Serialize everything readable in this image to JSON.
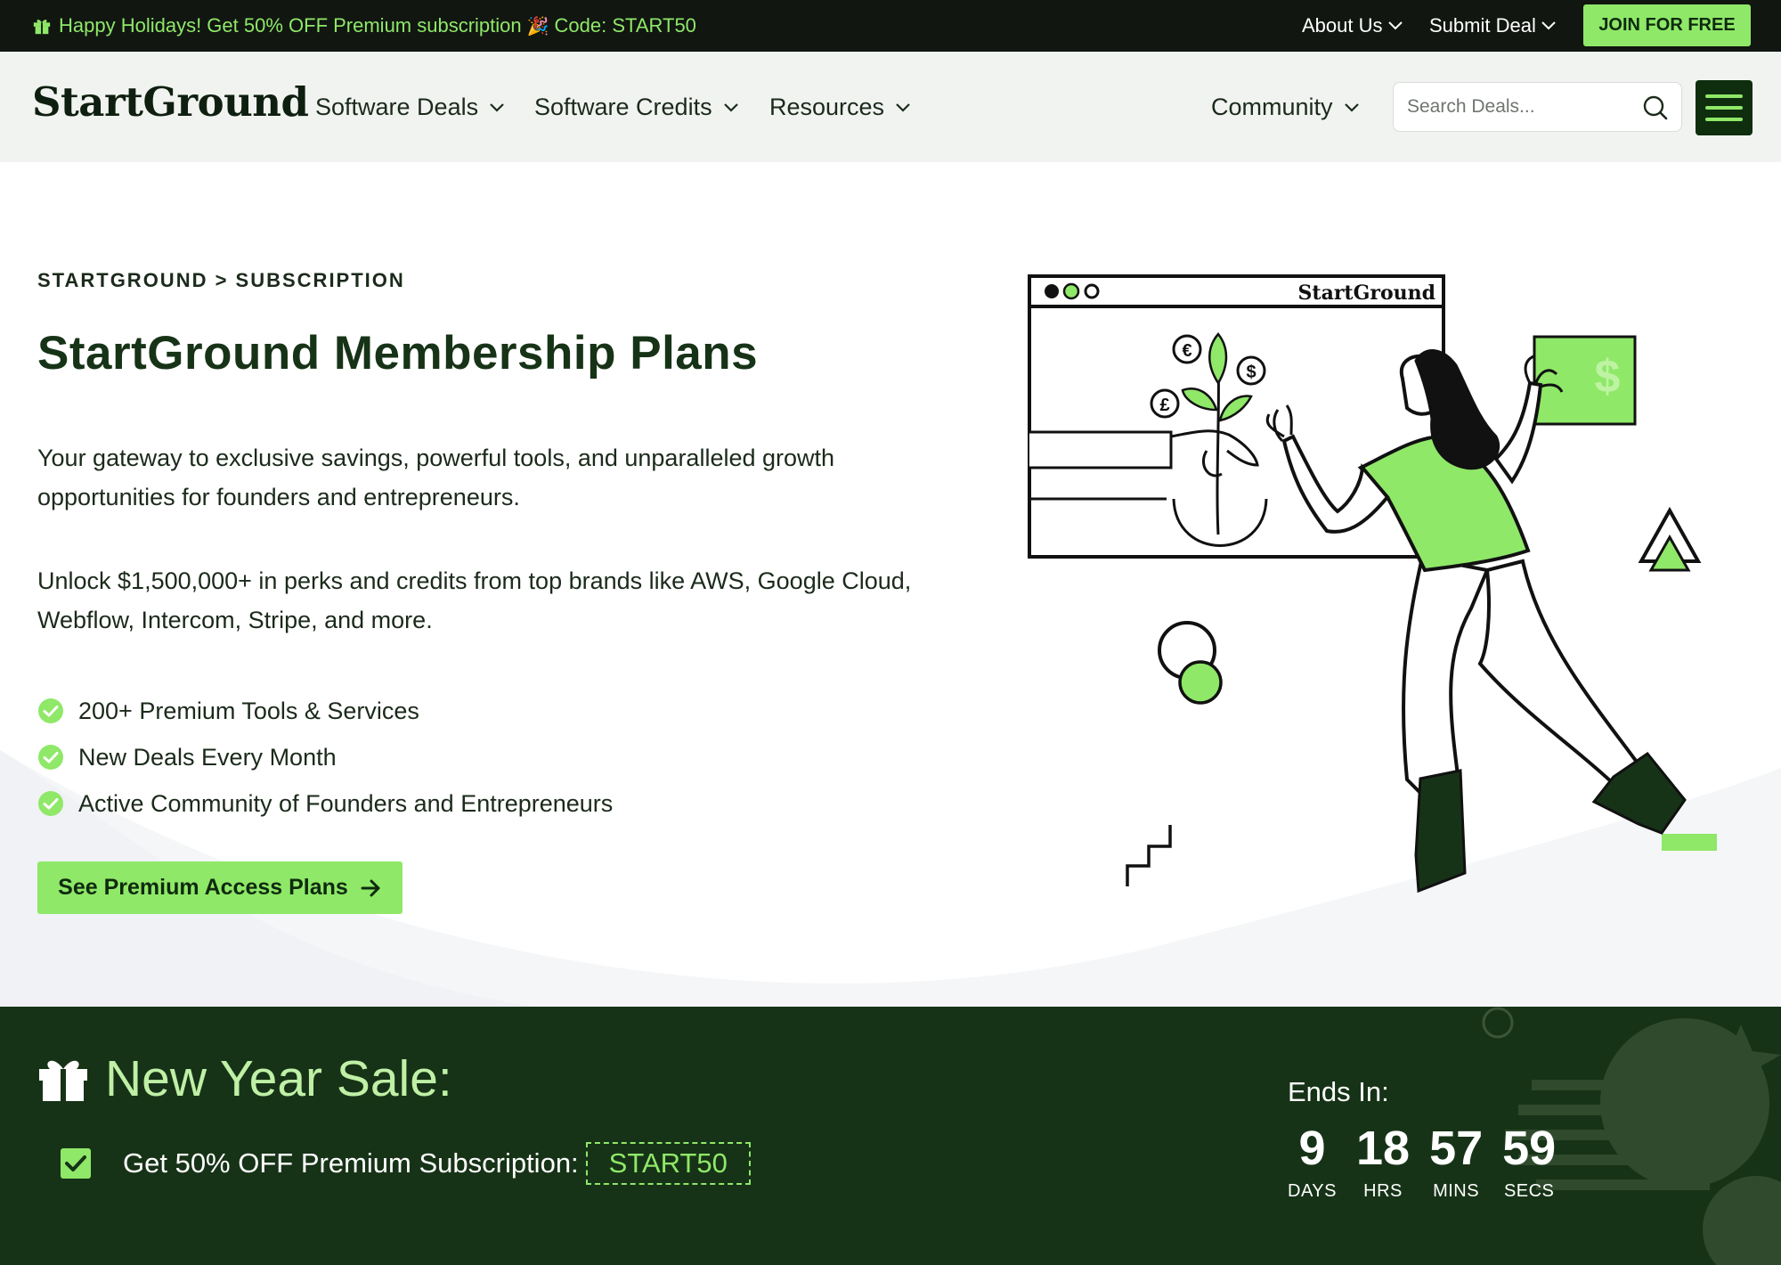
{
  "promo_bar": {
    "text_main": "Happy Holidays! Get 50% OFF Premium subscription",
    "text_code": "Code: START50",
    "about_us": "About Us",
    "submit_deal": "Submit Deal",
    "join_button": "JOIN FOR FREE"
  },
  "nav": {
    "logo": "StartGround",
    "items": [
      "Software Deals",
      "Software Credits",
      "Resources"
    ],
    "community": "Community",
    "search_placeholder": "Search Deals..."
  },
  "hero": {
    "breadcrumb": "STARTGROUND > SUBSCRIPTION",
    "title": "StartGround Membership Plans",
    "paragraph1": "Your gateway to exclusive savings, powerful tools, and unparalleled growth opportunities for founders and entrepreneurs.",
    "paragraph2": "Unlock $1,500,000+ in perks and credits from top brands like AWS, Google Cloud, Webflow, Intercom, Stripe, and more.",
    "features": [
      "200+ Premium Tools & Services",
      "New Deals Every Month",
      "Active Community of Founders and Entrepreneurs"
    ],
    "cta": "See Premium Access Plans",
    "illustration_logo": "StartGround"
  },
  "sale": {
    "title": "New Year Sale:",
    "offer": "Get 50% OFF Premium Subscription:",
    "code": "START50",
    "ends_label": "Ends In:",
    "countdown": [
      {
        "value": "9",
        "label": "DAYS"
      },
      {
        "value": "18",
        "label": "HRS"
      },
      {
        "value": "57",
        "label": "MINS"
      },
      {
        "value": "59",
        "label": "SECS"
      }
    ]
  },
  "colors": {
    "accent_green": "#8fe868",
    "dark_green": "#173317",
    "promo_bar_bg": "#111611",
    "nav_bg": "#f1f3f1"
  },
  "icons": [
    "gift-icon",
    "party-popper-icon",
    "chevron-down-icon",
    "search-icon",
    "hamburger-menu-icon",
    "check-circle-icon",
    "arrow-right-icon",
    "checkbox-checked-icon"
  ]
}
